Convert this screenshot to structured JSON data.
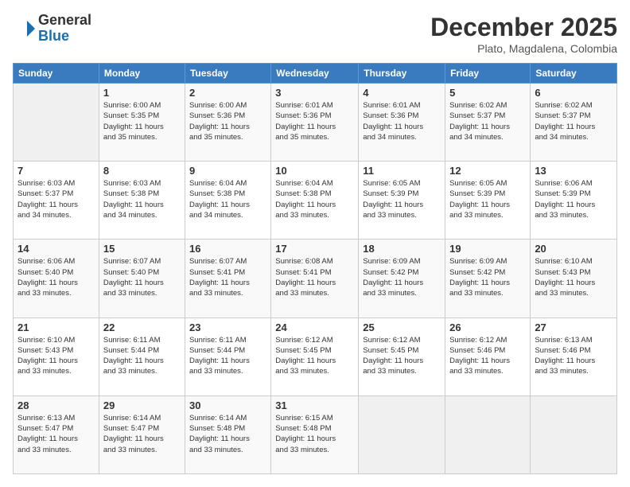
{
  "header": {
    "logo_general": "General",
    "logo_blue": "Blue",
    "month_year": "December 2025",
    "location": "Plato, Magdalena, Colombia"
  },
  "weekdays": [
    "Sunday",
    "Monday",
    "Tuesday",
    "Wednesday",
    "Thursday",
    "Friday",
    "Saturday"
  ],
  "weeks": [
    [
      {
        "day": "",
        "info": ""
      },
      {
        "day": "1",
        "info": "Sunrise: 6:00 AM\nSunset: 5:35 PM\nDaylight: 11 hours\nand 35 minutes."
      },
      {
        "day": "2",
        "info": "Sunrise: 6:00 AM\nSunset: 5:36 PM\nDaylight: 11 hours\nand 35 minutes."
      },
      {
        "day": "3",
        "info": "Sunrise: 6:01 AM\nSunset: 5:36 PM\nDaylight: 11 hours\nand 35 minutes."
      },
      {
        "day": "4",
        "info": "Sunrise: 6:01 AM\nSunset: 5:36 PM\nDaylight: 11 hours\nand 34 minutes."
      },
      {
        "day": "5",
        "info": "Sunrise: 6:02 AM\nSunset: 5:37 PM\nDaylight: 11 hours\nand 34 minutes."
      },
      {
        "day": "6",
        "info": "Sunrise: 6:02 AM\nSunset: 5:37 PM\nDaylight: 11 hours\nand 34 minutes."
      }
    ],
    [
      {
        "day": "7",
        "info": "Sunrise: 6:03 AM\nSunset: 5:37 PM\nDaylight: 11 hours\nand 34 minutes."
      },
      {
        "day": "8",
        "info": "Sunrise: 6:03 AM\nSunset: 5:38 PM\nDaylight: 11 hours\nand 34 minutes."
      },
      {
        "day": "9",
        "info": "Sunrise: 6:04 AM\nSunset: 5:38 PM\nDaylight: 11 hours\nand 34 minutes."
      },
      {
        "day": "10",
        "info": "Sunrise: 6:04 AM\nSunset: 5:38 PM\nDaylight: 11 hours\nand 33 minutes."
      },
      {
        "day": "11",
        "info": "Sunrise: 6:05 AM\nSunset: 5:39 PM\nDaylight: 11 hours\nand 33 minutes."
      },
      {
        "day": "12",
        "info": "Sunrise: 6:05 AM\nSunset: 5:39 PM\nDaylight: 11 hours\nand 33 minutes."
      },
      {
        "day": "13",
        "info": "Sunrise: 6:06 AM\nSunset: 5:39 PM\nDaylight: 11 hours\nand 33 minutes."
      }
    ],
    [
      {
        "day": "14",
        "info": "Sunrise: 6:06 AM\nSunset: 5:40 PM\nDaylight: 11 hours\nand 33 minutes."
      },
      {
        "day": "15",
        "info": "Sunrise: 6:07 AM\nSunset: 5:40 PM\nDaylight: 11 hours\nand 33 minutes."
      },
      {
        "day": "16",
        "info": "Sunrise: 6:07 AM\nSunset: 5:41 PM\nDaylight: 11 hours\nand 33 minutes."
      },
      {
        "day": "17",
        "info": "Sunrise: 6:08 AM\nSunset: 5:41 PM\nDaylight: 11 hours\nand 33 minutes."
      },
      {
        "day": "18",
        "info": "Sunrise: 6:09 AM\nSunset: 5:42 PM\nDaylight: 11 hours\nand 33 minutes."
      },
      {
        "day": "19",
        "info": "Sunrise: 6:09 AM\nSunset: 5:42 PM\nDaylight: 11 hours\nand 33 minutes."
      },
      {
        "day": "20",
        "info": "Sunrise: 6:10 AM\nSunset: 5:43 PM\nDaylight: 11 hours\nand 33 minutes."
      }
    ],
    [
      {
        "day": "21",
        "info": "Sunrise: 6:10 AM\nSunset: 5:43 PM\nDaylight: 11 hours\nand 33 minutes."
      },
      {
        "day": "22",
        "info": "Sunrise: 6:11 AM\nSunset: 5:44 PM\nDaylight: 11 hours\nand 33 minutes."
      },
      {
        "day": "23",
        "info": "Sunrise: 6:11 AM\nSunset: 5:44 PM\nDaylight: 11 hours\nand 33 minutes."
      },
      {
        "day": "24",
        "info": "Sunrise: 6:12 AM\nSunset: 5:45 PM\nDaylight: 11 hours\nand 33 minutes."
      },
      {
        "day": "25",
        "info": "Sunrise: 6:12 AM\nSunset: 5:45 PM\nDaylight: 11 hours\nand 33 minutes."
      },
      {
        "day": "26",
        "info": "Sunrise: 6:12 AM\nSunset: 5:46 PM\nDaylight: 11 hours\nand 33 minutes."
      },
      {
        "day": "27",
        "info": "Sunrise: 6:13 AM\nSunset: 5:46 PM\nDaylight: 11 hours\nand 33 minutes."
      }
    ],
    [
      {
        "day": "28",
        "info": "Sunrise: 6:13 AM\nSunset: 5:47 PM\nDaylight: 11 hours\nand 33 minutes."
      },
      {
        "day": "29",
        "info": "Sunrise: 6:14 AM\nSunset: 5:47 PM\nDaylight: 11 hours\nand 33 minutes."
      },
      {
        "day": "30",
        "info": "Sunrise: 6:14 AM\nSunset: 5:48 PM\nDaylight: 11 hours\nand 33 minutes."
      },
      {
        "day": "31",
        "info": "Sunrise: 6:15 AM\nSunset: 5:48 PM\nDaylight: 11 hours\nand 33 minutes."
      },
      {
        "day": "",
        "info": ""
      },
      {
        "day": "",
        "info": ""
      },
      {
        "day": "",
        "info": ""
      }
    ]
  ]
}
